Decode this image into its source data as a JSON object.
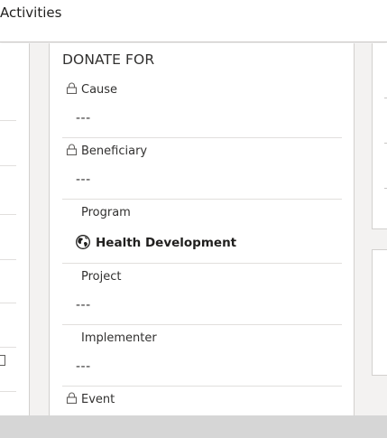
{
  "topbar": {
    "title": "Activities"
  },
  "section": {
    "title": "DONATE FOR",
    "fields": [
      {
        "label": "Cause",
        "value": "---",
        "locked": true
      },
      {
        "label": "Beneficiary",
        "value": "---",
        "locked": true
      },
      {
        "label": "Program",
        "value": "Health Development",
        "locked": false,
        "icon": "globe-icon"
      },
      {
        "label": "Project",
        "value": "---",
        "locked": false
      },
      {
        "label": "Implementer",
        "value": "---",
        "locked": false
      },
      {
        "label": "Event",
        "locked": true
      }
    ]
  },
  "colors": {
    "canvas": "#f3f2f1",
    "border": "#d2d0ce",
    "divider": "#e1dfdd",
    "text": "#323130",
    "statusbar": "#d6d6d6"
  }
}
